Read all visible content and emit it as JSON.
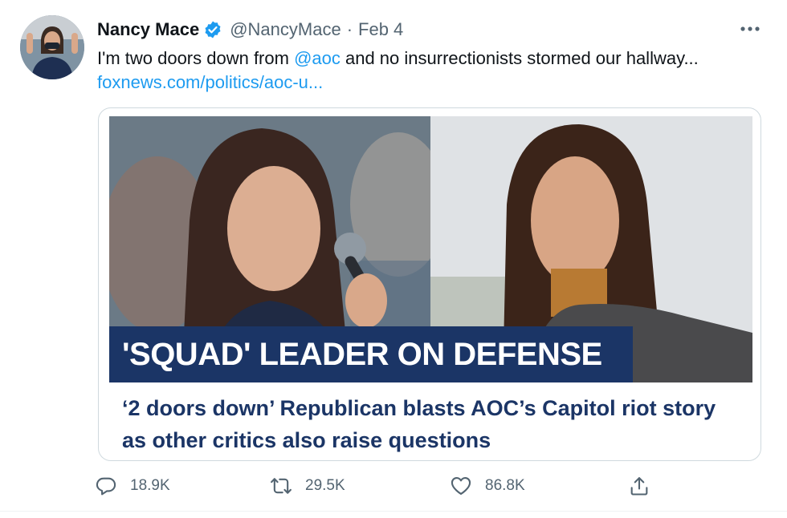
{
  "tweet": {
    "author_name": "Nancy Mace",
    "handle": "@NancyMace",
    "separator": "·",
    "date": "Feb 4",
    "text_before_mention": "I'm two doors down from ",
    "mention": "@aoc",
    "text_after_mention": " and no insurrectionists stormed our hallway... ",
    "link_text": "foxnews.com/politics/aoc-u..."
  },
  "card": {
    "banner_text": "'SQUAD' LEADER ON DEFENSE",
    "headline": "‘2 doors down’ Republican blasts AOC’s Capitol riot story as other critics also raise questions"
  },
  "actions": {
    "reply_count": "18.9K",
    "retweet_count": "29.5K",
    "like_count": "86.8K"
  },
  "icons": {
    "verified": "verified-badge-icon",
    "more": "more-horizontal-icon",
    "reply": "reply-icon",
    "retweet": "retweet-icon",
    "like": "heart-icon",
    "share": "share-icon"
  },
  "colors": {
    "link": "#1d9bf0",
    "banner_bg": "#1b3566",
    "headline": "#1b3566",
    "secondary_text": "#536471"
  }
}
